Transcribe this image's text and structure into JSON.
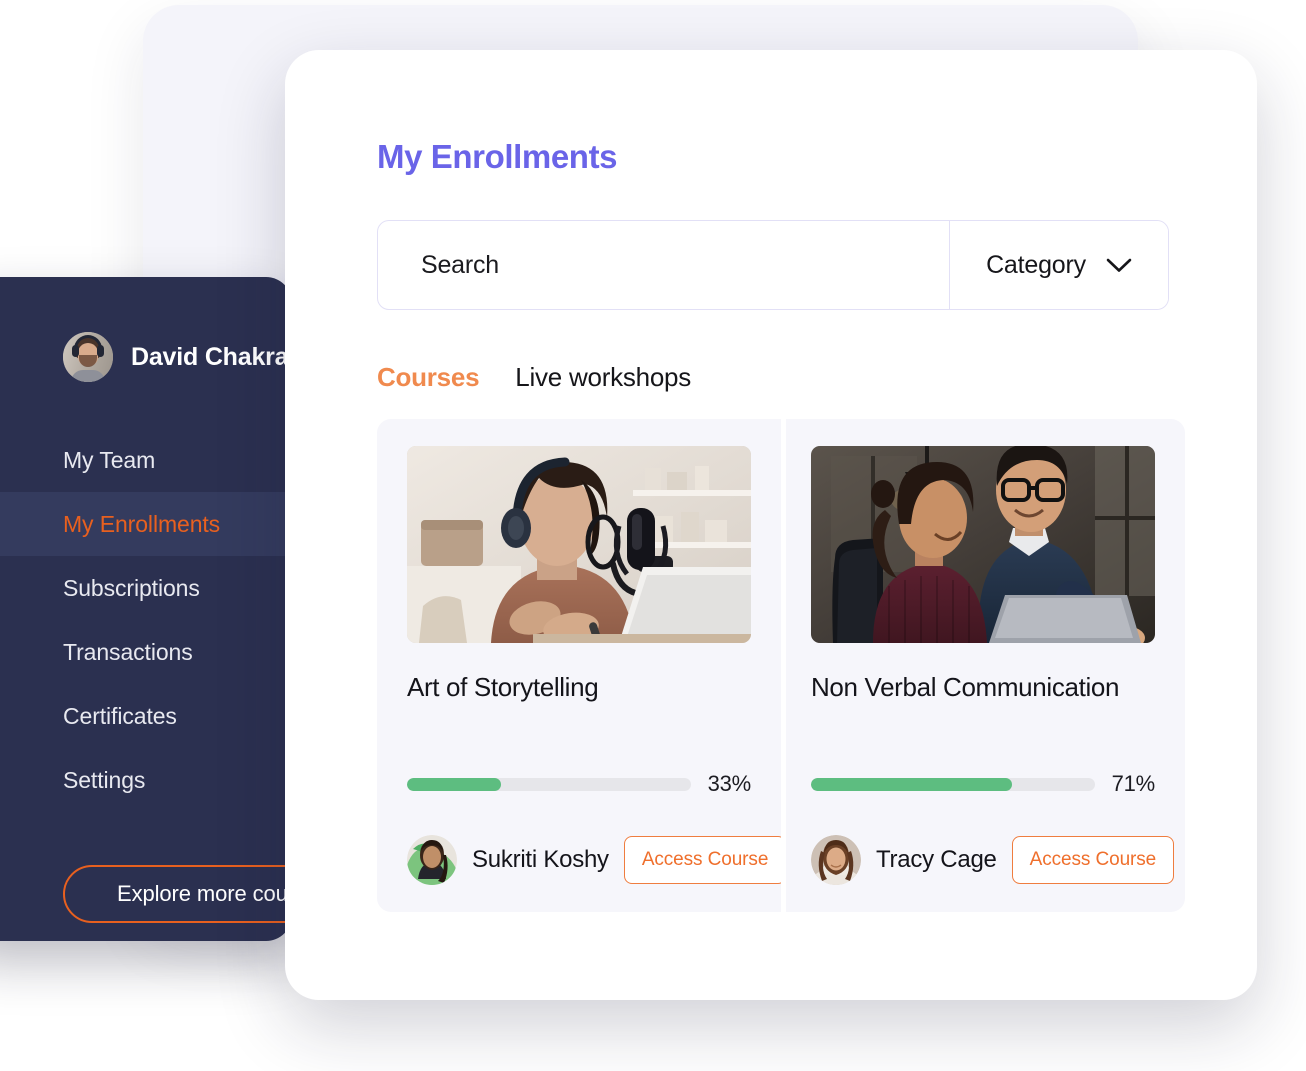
{
  "sidebar": {
    "user": {
      "name": "David Chakra",
      "avatar_icon": "user-avatar-headphones"
    },
    "items": [
      {
        "label": "My Team",
        "active": false
      },
      {
        "label": "My Enrollments",
        "active": true
      },
      {
        "label": "Subscriptions",
        "active": false
      },
      {
        "label": "Transactions",
        "active": false
      },
      {
        "label": "Certificates",
        "active": false
      },
      {
        "label": "Settings",
        "active": false
      }
    ],
    "cta_label": "Explore more courses",
    "colors": {
      "bg": "#2b3050",
      "active_bg": "#343b5e",
      "accent": "#e8601f"
    }
  },
  "main": {
    "title": "My Enrollments",
    "title_color": "#6a64e8",
    "search": {
      "value": "",
      "placeholder": "Search",
      "icon": "search-icon"
    },
    "category": {
      "label": "Category",
      "icon": "chevron-down-icon"
    },
    "tabs": [
      {
        "label": "Courses",
        "active": true
      },
      {
        "label": "Live workshops",
        "active": false
      }
    ],
    "tab_active_color": "#f08a4e",
    "courses": [
      {
        "title": "Art of Storytelling",
        "progress": 33,
        "progress_label": "33%",
        "instructor": "Sukriti Koshy",
        "action_label": "Access Course",
        "thumbnail_icon": "podcast-woman-microphone-photo"
      },
      {
        "title": "Non Verbal Communication",
        "progress": 71,
        "progress_label": "71%",
        "instructor": "Tracy Cage",
        "action_label": "Access Course",
        "thumbnail_icon": "two-colleagues-laptop-photo"
      }
    ],
    "progress_color": "#5dbd80",
    "action_color": "#ef6f2c"
  }
}
